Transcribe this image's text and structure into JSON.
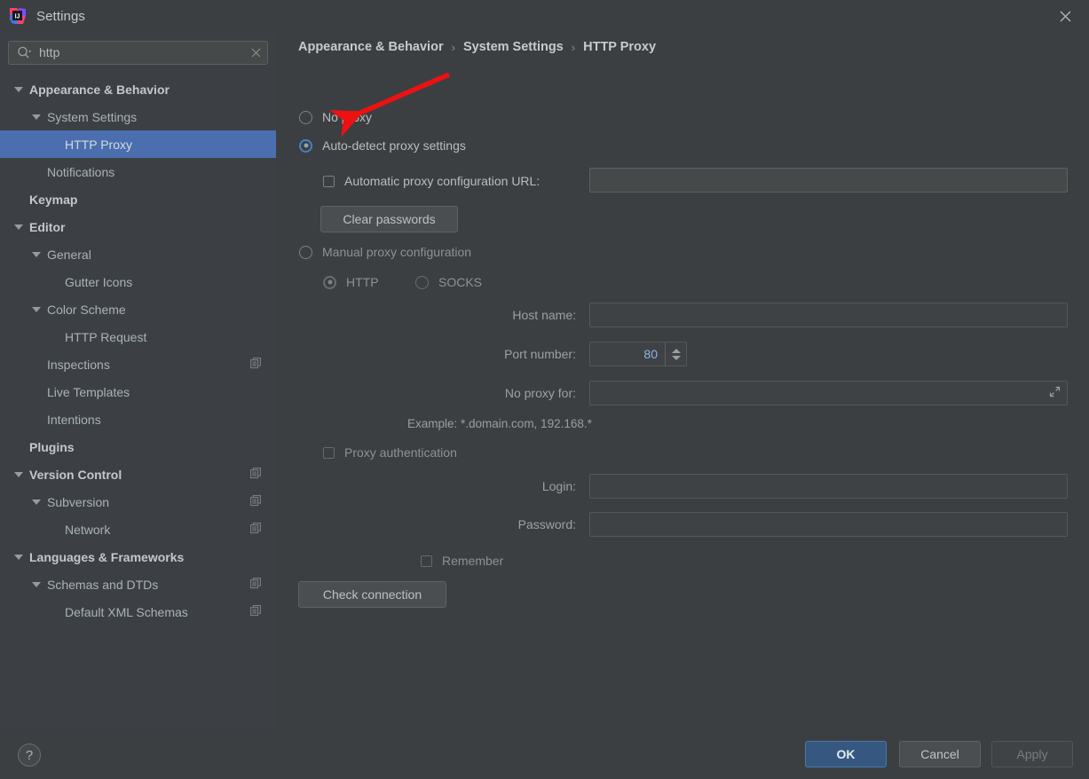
{
  "window": {
    "title": "Settings",
    "app_icon": "intellij-idea-logo",
    "close_icon": "close-icon"
  },
  "search": {
    "value": "http",
    "placeholder": "",
    "icon": "search-icon",
    "clear_icon": "clear-icon"
  },
  "sidebar": {
    "items": [
      {
        "label": "Appearance & Behavior",
        "indent": 0,
        "arrow": "down",
        "bold": true,
        "selected": false,
        "copy_icon": false
      },
      {
        "label": "System Settings",
        "indent": 1,
        "arrow": "down",
        "bold": false,
        "selected": false,
        "copy_icon": false
      },
      {
        "label": "HTTP Proxy",
        "indent": 2,
        "arrow": "none",
        "bold": false,
        "selected": true,
        "copy_icon": false
      },
      {
        "label": "Notifications",
        "indent": 1,
        "arrow": "none",
        "bold": false,
        "selected": false,
        "copy_icon": false
      },
      {
        "label": "Keymap",
        "indent": 0,
        "arrow": "none",
        "bold": true,
        "selected": false,
        "copy_icon": false
      },
      {
        "label": "Editor",
        "indent": 0,
        "arrow": "down",
        "bold": true,
        "selected": false,
        "copy_icon": false
      },
      {
        "label": "General",
        "indent": 1,
        "arrow": "down",
        "bold": false,
        "selected": false,
        "copy_icon": false
      },
      {
        "label": "Gutter Icons",
        "indent": 2,
        "arrow": "none",
        "bold": false,
        "selected": false,
        "copy_icon": false
      },
      {
        "label": "Color Scheme",
        "indent": 1,
        "arrow": "down",
        "bold": false,
        "selected": false,
        "copy_icon": false
      },
      {
        "label": "HTTP Request",
        "indent": 2,
        "arrow": "none",
        "bold": false,
        "selected": false,
        "copy_icon": false
      },
      {
        "label": "Inspections",
        "indent": 1,
        "arrow": "none",
        "bold": false,
        "selected": false,
        "copy_icon": true
      },
      {
        "label": "Live Templates",
        "indent": 1,
        "arrow": "none",
        "bold": false,
        "selected": false,
        "copy_icon": false
      },
      {
        "label": "Intentions",
        "indent": 1,
        "arrow": "none",
        "bold": false,
        "selected": false,
        "copy_icon": false
      },
      {
        "label": "Plugins",
        "indent": 0,
        "arrow": "none",
        "bold": true,
        "selected": false,
        "copy_icon": false
      },
      {
        "label": "Version Control",
        "indent": 0,
        "arrow": "down",
        "bold": true,
        "selected": false,
        "copy_icon": true
      },
      {
        "label": "Subversion",
        "indent": 1,
        "arrow": "down",
        "bold": false,
        "selected": false,
        "copy_icon": true
      },
      {
        "label": "Network",
        "indent": 2,
        "arrow": "none",
        "bold": false,
        "selected": false,
        "copy_icon": true
      },
      {
        "label": "Languages & Frameworks",
        "indent": 0,
        "arrow": "down",
        "bold": true,
        "selected": false,
        "copy_icon": false
      },
      {
        "label": "Schemas and DTDs",
        "indent": 1,
        "arrow": "down",
        "bold": false,
        "selected": false,
        "copy_icon": true
      },
      {
        "label": "Default XML Schemas",
        "indent": 2,
        "arrow": "none",
        "bold": false,
        "selected": false,
        "copy_icon": true
      }
    ]
  },
  "main": {
    "breadcrumb": {
      "part1": "Appearance & Behavior",
      "sep1": "›",
      "part2": "System Settings",
      "sep2": "›",
      "part3": "HTTP Proxy"
    },
    "proxy_mode": {
      "no_proxy": "No proxy",
      "auto_detect": "Auto-detect proxy settings",
      "manual": "Manual proxy configuration",
      "selected": "auto_detect"
    },
    "auto_pac_label": "Automatic proxy configuration URL:",
    "auto_pac_value": "",
    "auto_pac_checked": false,
    "clear_passwords_button": "Clear passwords",
    "protocol": {
      "http": "HTTP",
      "socks": "SOCKS",
      "selected": "HTTP"
    },
    "host_name_label": "Host name:",
    "host_name_value": "",
    "port_label": "Port number:",
    "port_value": "80",
    "no_proxy_for_label": "No proxy for:",
    "no_proxy_for_value": "",
    "no_proxy_expand_icon": "expand-icon",
    "example_hint": "Example: *.domain.com, 192.168.*",
    "proxy_auth_label": "Proxy authentication",
    "proxy_auth_checked": false,
    "login_label": "Login:",
    "login_value": "",
    "password_label": "Password:",
    "password_value": "",
    "remember_label": "Remember",
    "remember_checked": false,
    "check_connection_button": "Check connection"
  },
  "annotation": {
    "arrow_color": "#ee1111",
    "points_to": "Auto-detect proxy settings"
  },
  "footer": {
    "help_label": "?",
    "ok": "OK",
    "cancel": "Cancel",
    "apply": "Apply"
  },
  "colors": {
    "window_bg": "#3c3f41",
    "sidebar_bg": "#3c4044",
    "selection_blue": "#4b6eaf",
    "primary_button": "#365880",
    "accent_radio": "#3e83c6",
    "field_bg": "#45494a",
    "text": "#bbbbbb"
  }
}
